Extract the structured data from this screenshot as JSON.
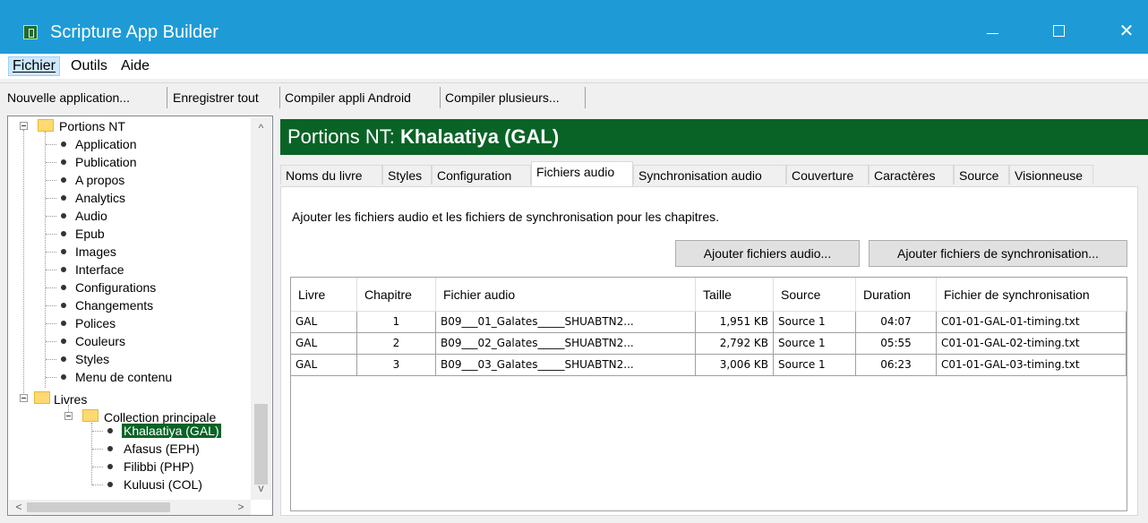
{
  "window": {
    "title": "Scripture App Builder",
    "app_icon": "scripture-app-builder-icon"
  },
  "menu": {
    "items": [
      {
        "label": "Fichier",
        "access_key": "F"
      },
      {
        "label": "Outils",
        "access_key": "t"
      },
      {
        "label": "Aide",
        "access_key": ""
      }
    ]
  },
  "toolbar": {
    "items": [
      "Nouvelle application...",
      "Enregistrer tout",
      "Compiler appli Android",
      "Compiler plusieurs..."
    ]
  },
  "tree": {
    "root": "Portions NT",
    "settings": [
      "Application",
      "Publication",
      "A propos",
      "Analytics",
      "Audio",
      "Epub",
      "Images",
      "Interface",
      "Configurations",
      "Changements",
      "Polices",
      "Couleurs",
      "Styles",
      "Menu de contenu"
    ],
    "books_folder": "Livres",
    "collection": "Collection principale",
    "books": [
      "Khalaatiya (GAL)",
      "Afasus (EPH)",
      "Filibbi (PHP)",
      "Kuluusi (COL)"
    ],
    "selected_book": "Khalaatiya (GAL)"
  },
  "panel": {
    "title_prefix": "Portions NT: ",
    "title_book": "Khalaatiya  (GAL)"
  },
  "tabs": [
    "Noms du livre",
    "Styles",
    "Configuration",
    "Fichiers audio",
    "Synchronisation audio",
    "Couverture",
    "Caractères",
    "Source",
    "Visionneuse"
  ],
  "active_tab": "Fichiers audio",
  "audio": {
    "description": "Ajouter les fichiers audio et les fichiers de synchronisation pour les chapitres.",
    "add_audio_button": "Ajouter fichiers audio...",
    "add_sync_button": "Ajouter fichiers de synchronisation...",
    "columns": [
      "Livre",
      "Chapitre",
      "Fichier audio",
      "Taille",
      "Source",
      "Duration",
      "Fichier de synchronisation"
    ],
    "rows": [
      {
        "book": "GAL",
        "chapter": "1",
        "file": "B09___01_Galates_____SHUABTN2...",
        "size": "1,951 KB",
        "source": "Source 1",
        "duration": "04:07",
        "sync": "C01-01-GAL-01-timing.txt"
      },
      {
        "book": "GAL",
        "chapter": "2",
        "file": "B09___02_Galates_____SHUABTN2...",
        "size": "2,792 KB",
        "source": "Source 1",
        "duration": "05:55",
        "sync": "C01-01-GAL-02-timing.txt"
      },
      {
        "book": "GAL",
        "chapter": "3",
        "file": "B09___03_Galates_____SHUABTN2...",
        "size": "3,006 KB",
        "source": "Source 1",
        "duration": "06:23",
        "sync": "C01-01-GAL-03-timing.txt"
      }
    ]
  },
  "colors": {
    "titlebar": "#1e9bd7",
    "header": "#0a6326",
    "selection": "#0a6326"
  },
  "icons": {
    "minimize": "minimize-icon",
    "maximize": "maximize-icon",
    "close": "close-icon",
    "folder": "folder-icon",
    "bullet": "bullet-icon"
  }
}
